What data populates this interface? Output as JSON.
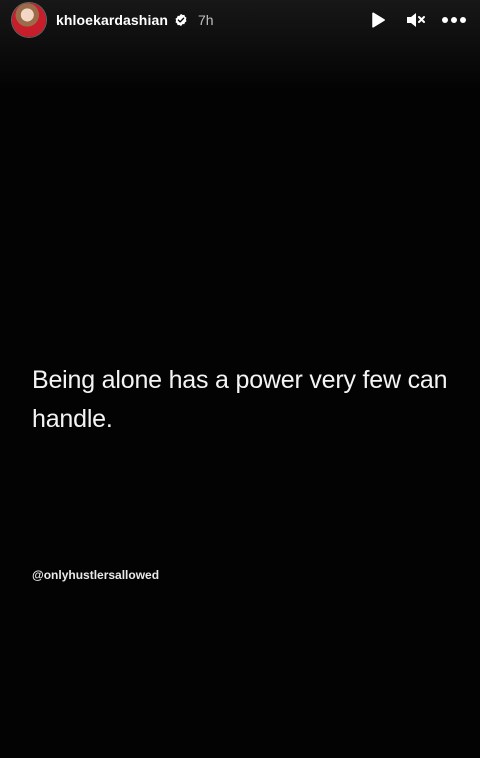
{
  "header": {
    "username": "khloekardashian",
    "time": "7h",
    "avatar_icon": "profile-photo",
    "verified_icon": "verified-badge-icon"
  },
  "controls": {
    "play_icon": "play-icon",
    "mute_icon": "muted-speaker-icon",
    "more_icon": "more-options-icon"
  },
  "post": {
    "quote": "Being alone has a power very few can handle.",
    "source_handle": "@onlyhustlersallowed"
  },
  "colors": {
    "background": "#030303",
    "text": "#f4f4f4",
    "avatar_accent": "#c81d2b"
  }
}
